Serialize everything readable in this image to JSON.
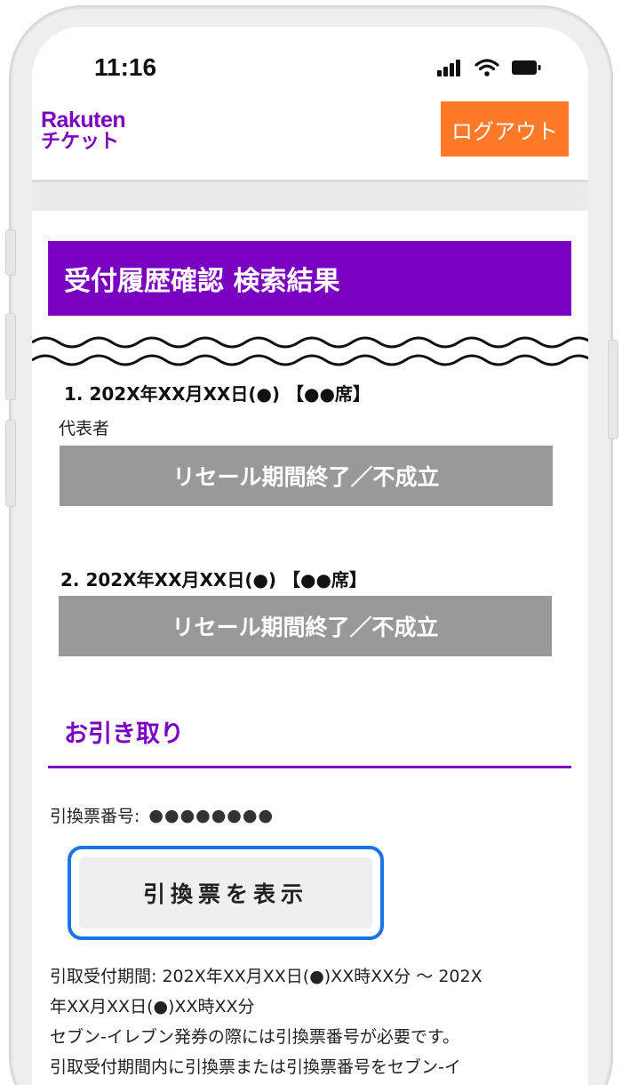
{
  "status_bar": {
    "time": "11:16",
    "icons": [
      "signal-icon",
      "wifi-icon",
      "battery-icon"
    ]
  },
  "header": {
    "logo_line1": "Rakuten",
    "logo_line2": "チケット",
    "logout_label": "ログアウト"
  },
  "page": {
    "title": "受付履歴確認 検索結果"
  },
  "entries": [
    {
      "heading": "1. 202X年XX月XX日(●) 【●●席】",
      "role": "代表者",
      "status": "リセール期間終了／不成立"
    },
    {
      "heading": "2. 202X年XX月XX日(●) 【●●席】",
      "status": "リセール期間終了／不成立"
    }
  ],
  "pickup": {
    "section_title": "お引き取り",
    "voucher_label": "引換票番号:",
    "voucher_value": "●●●●●●●●",
    "show_button": "引換票を表示",
    "period_line1": "引取受付期間: 202X年XX月XX日(●)XX時XX分 ～ 202X",
    "period_line2": "年XX月XX日(●)XX時XX分",
    "note1": "セブン-イレブン発券の際には引換票番号が必要です。",
    "note2": "引取受付期間内に引換票または引換票番号をセブン-イ"
  },
  "colors": {
    "brand_purple": "#7a00c2",
    "logout_orange": "#ff7a28",
    "status_gray": "#999999",
    "focus_blue": "#1a73e8"
  }
}
